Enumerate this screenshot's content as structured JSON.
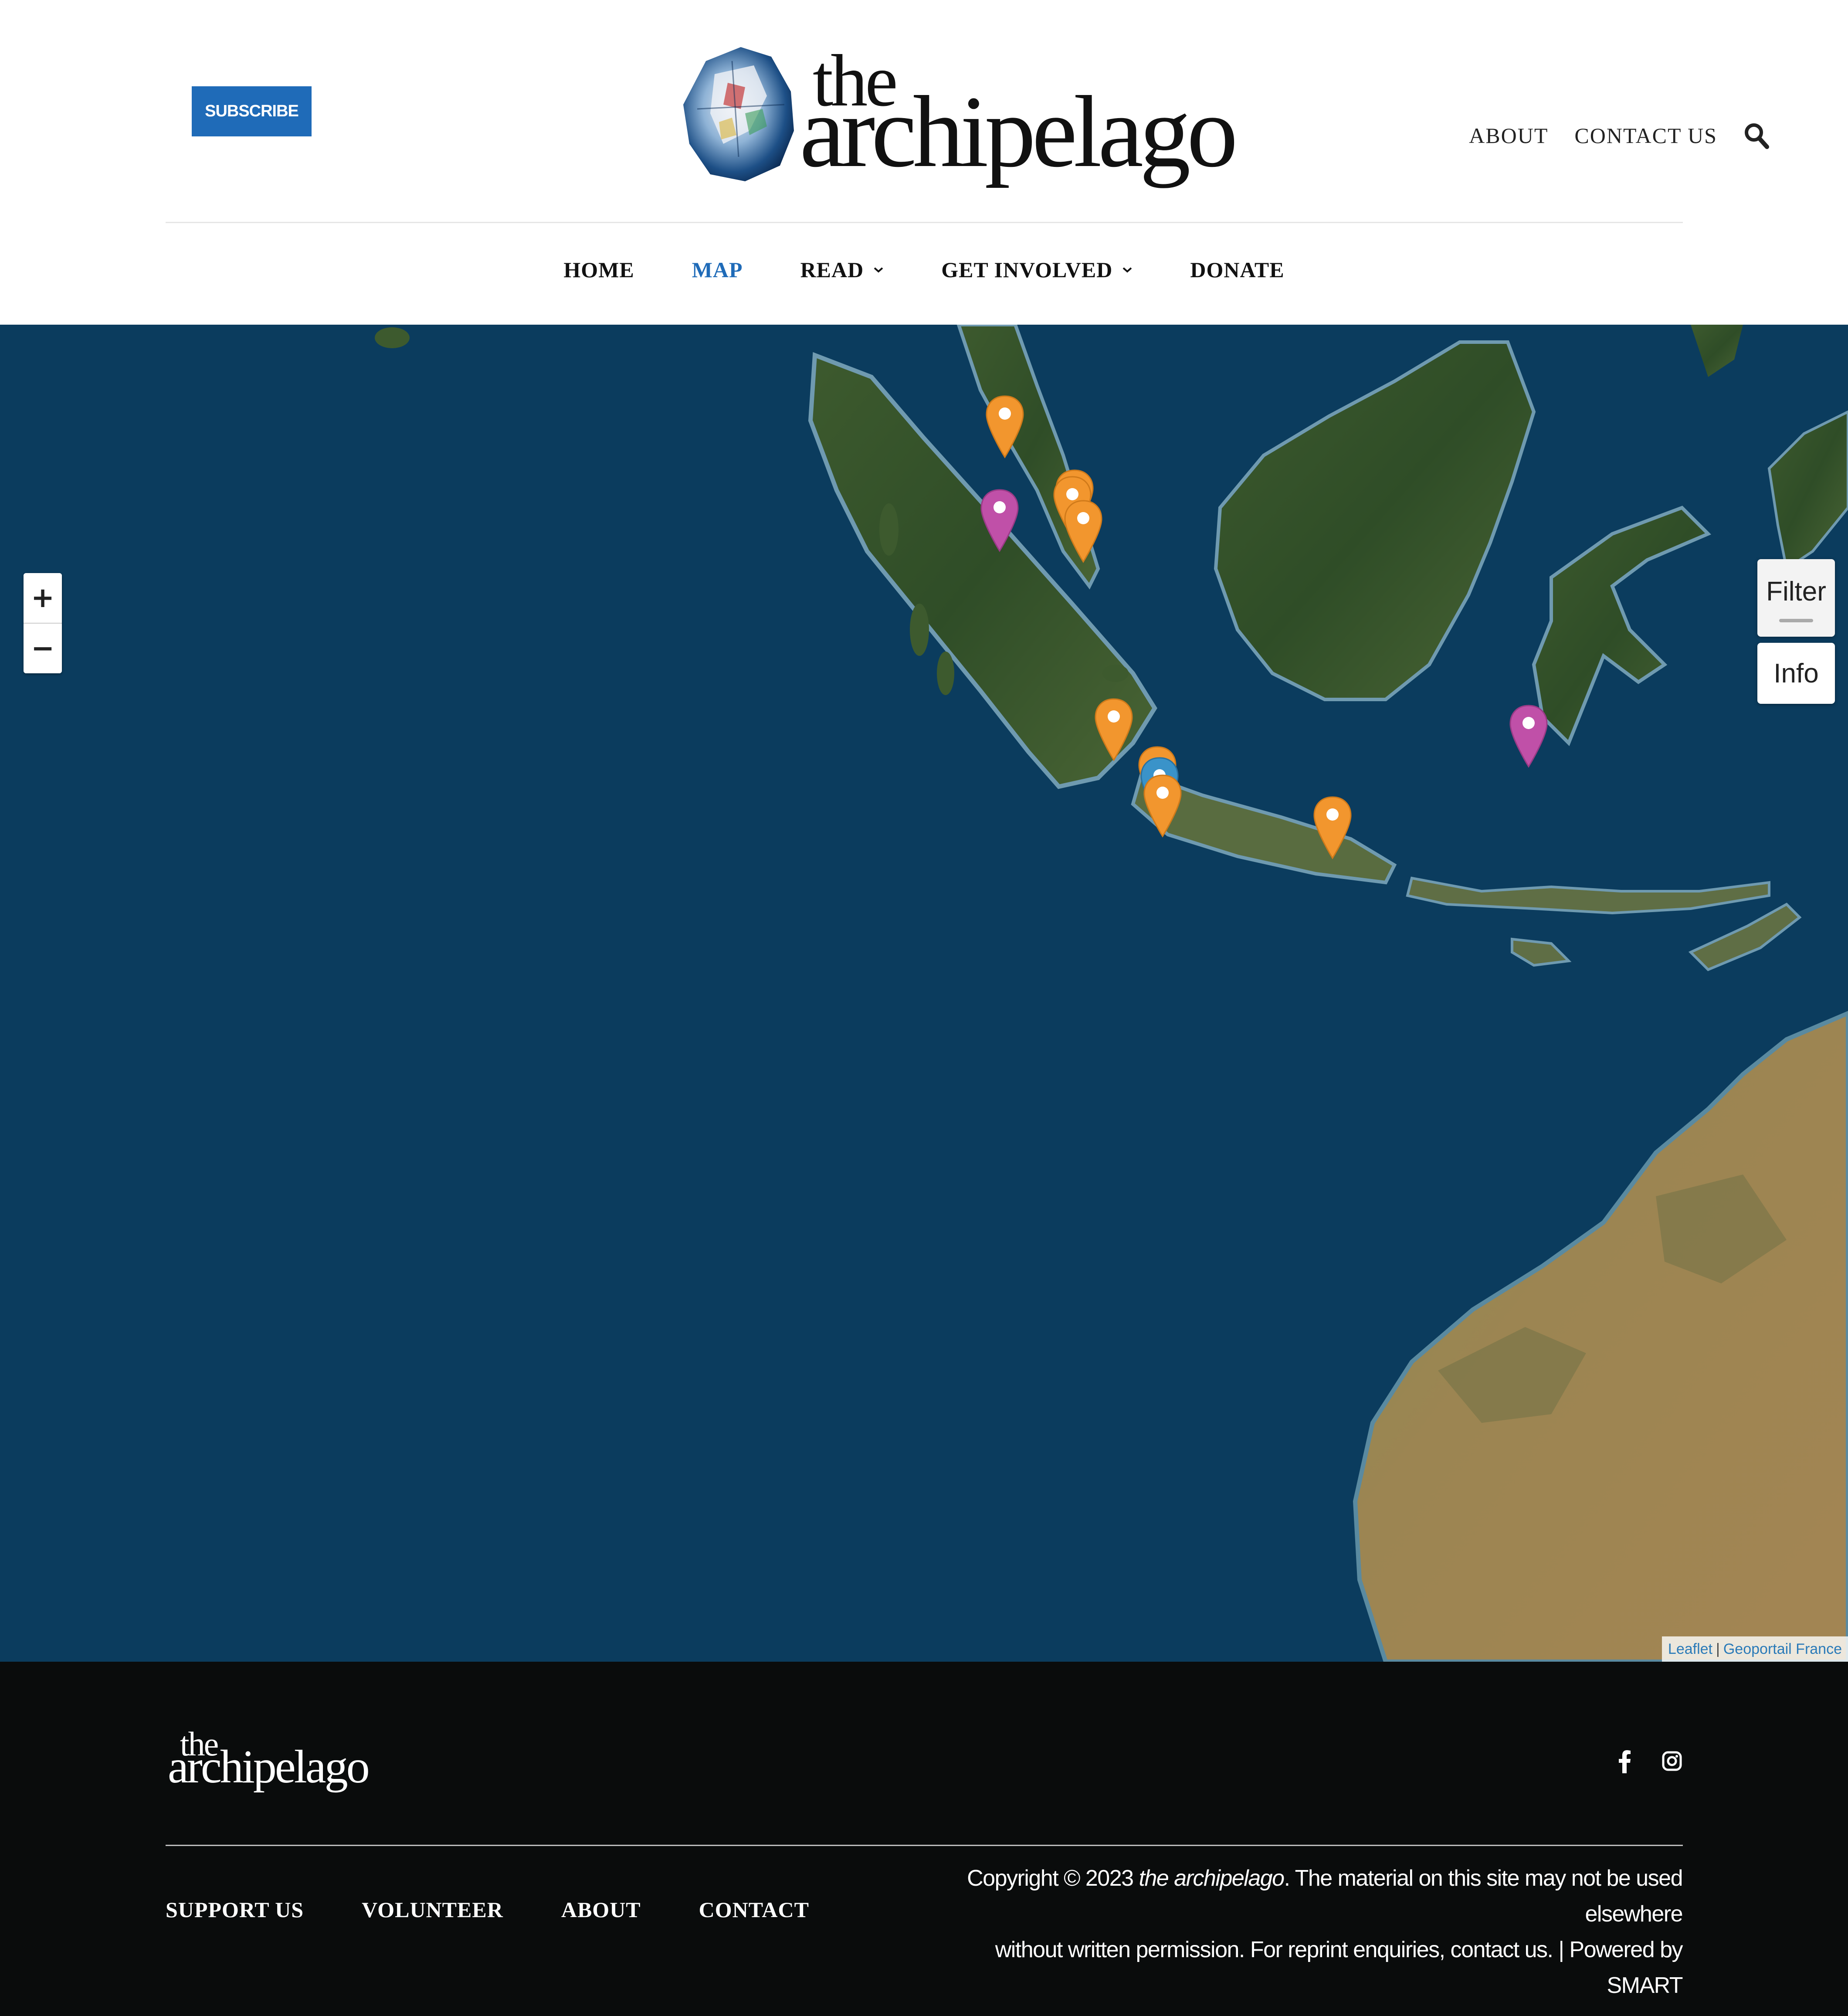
{
  "header": {
    "subscribe_label": "SUBSCRIBE",
    "logo": {
      "line1": "the",
      "line2": "archipelago"
    },
    "top_links": [
      "ABOUT",
      "CONTACT US"
    ],
    "search_icon": "search-icon"
  },
  "nav": {
    "items": [
      {
        "label": "HOME",
        "active": false,
        "dropdown": false
      },
      {
        "label": "MAP",
        "active": true,
        "dropdown": false
      },
      {
        "label": "READ",
        "active": false,
        "dropdown": true
      },
      {
        "label": "GET INVOLVED",
        "active": false,
        "dropdown": true
      },
      {
        "label": "DONATE",
        "active": false,
        "dropdown": false
      }
    ],
    "active_color": "#1f6bb8"
  },
  "map": {
    "zoom_in": "+",
    "zoom_out": "−",
    "filter_label": "Filter",
    "info_label": "Info",
    "attribution": {
      "leaflet": "Leaflet",
      "separator": "|",
      "provider": "Geoportail France"
    },
    "ocean_color": "#0b3c5e",
    "marker_colors": {
      "orange": "#f2962e",
      "magenta": "#c050a8",
      "blue": "#3a93c9"
    },
    "markers": [
      {
        "color": "orange"
      },
      {
        "color": "orange"
      },
      {
        "color": "orange"
      },
      {
        "color": "orange"
      },
      {
        "color": "magenta"
      },
      {
        "color": "orange"
      },
      {
        "color": "orange"
      },
      {
        "color": "blue"
      },
      {
        "color": "orange"
      },
      {
        "color": "orange"
      },
      {
        "color": "magenta"
      }
    ]
  },
  "footer": {
    "logo": {
      "line1": "the",
      "line2": "archipelago"
    },
    "social": [
      "facebook-icon",
      "instagram-icon"
    ],
    "links": [
      "SUPPORT US",
      "VOLUNTEER",
      "ABOUT",
      "CONTACT"
    ],
    "copyright": {
      "prefix": "Copyright © 2023 ",
      "site_name": "the archipelago",
      "line1_rest": ". The material on this site may not be used elsewhere",
      "line2": "without written permission. For reprint enquiries, contact us. | Powered by SMART"
    }
  }
}
